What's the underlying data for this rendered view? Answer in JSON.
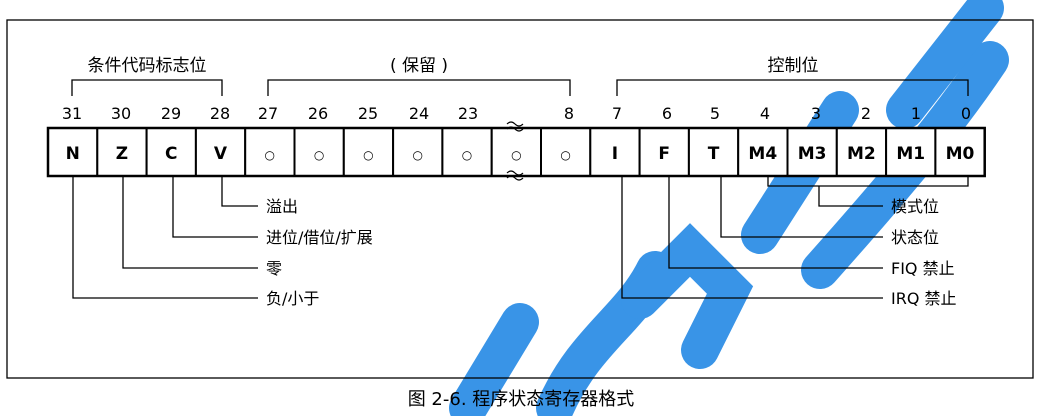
{
  "diagram": {
    "group_labels": {
      "flags": "条件代码标志位",
      "reserved": "( 保留 )",
      "control": "控制位"
    },
    "bit_numbers": [
      "31",
      "30",
      "29",
      "28",
      "27",
      "26",
      "25",
      "24",
      "23",
      "8",
      "7",
      "6",
      "5",
      "4",
      "3",
      "2",
      "1",
      "0"
    ],
    "cells": [
      "N",
      "Z",
      "C",
      "V",
      "○",
      "○",
      "○",
      "○",
      "○",
      "○",
      "○",
      "I",
      "F",
      "T",
      "M4",
      "M3",
      "M2",
      "M1",
      "M0"
    ],
    "break_mark": "≈",
    "left_annotations": {
      "overflow": "溢出",
      "carry": "进位/借位/扩展",
      "zero": "零",
      "negative": "负/小于"
    },
    "right_annotations": {
      "mode": "模式位",
      "state": "状态位",
      "fiq": "FIQ 禁止",
      "irq": "IRQ 禁止"
    },
    "watermark": "rqianl"
  },
  "caption": "图 2-6. 程序状态寄存器格式",
  "colors": {
    "line": "#000000",
    "watermark": "#2f8fe6",
    "background": "#ffffff"
  }
}
